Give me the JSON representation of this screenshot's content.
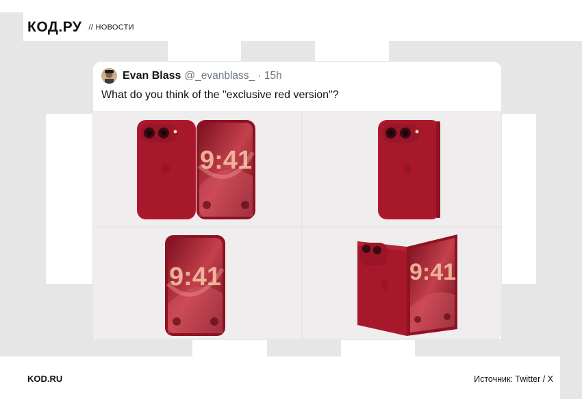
{
  "header": {
    "logo": "КОД.РУ",
    "section": "// НОВОСТИ"
  },
  "tweet": {
    "author_name": "Evan Blass",
    "handle_time": "@_evanblass_ · 15h",
    "text": "What do you think of the \"exclusive red version\"?",
    "clock": "9:41",
    "images": [
      {
        "name": "phone-open-front-back"
      },
      {
        "name": "phone-closed-back"
      },
      {
        "name": "phone-front-screen"
      },
      {
        "name": "phone-half-folded"
      }
    ]
  },
  "footer": {
    "site": "KOD.RU",
    "source": "Источник: Twitter / X"
  },
  "colors": {
    "phone_red": "#b01a2e",
    "handle_gray": "#6b7680",
    "bg_gray": "#e6e6e6"
  }
}
